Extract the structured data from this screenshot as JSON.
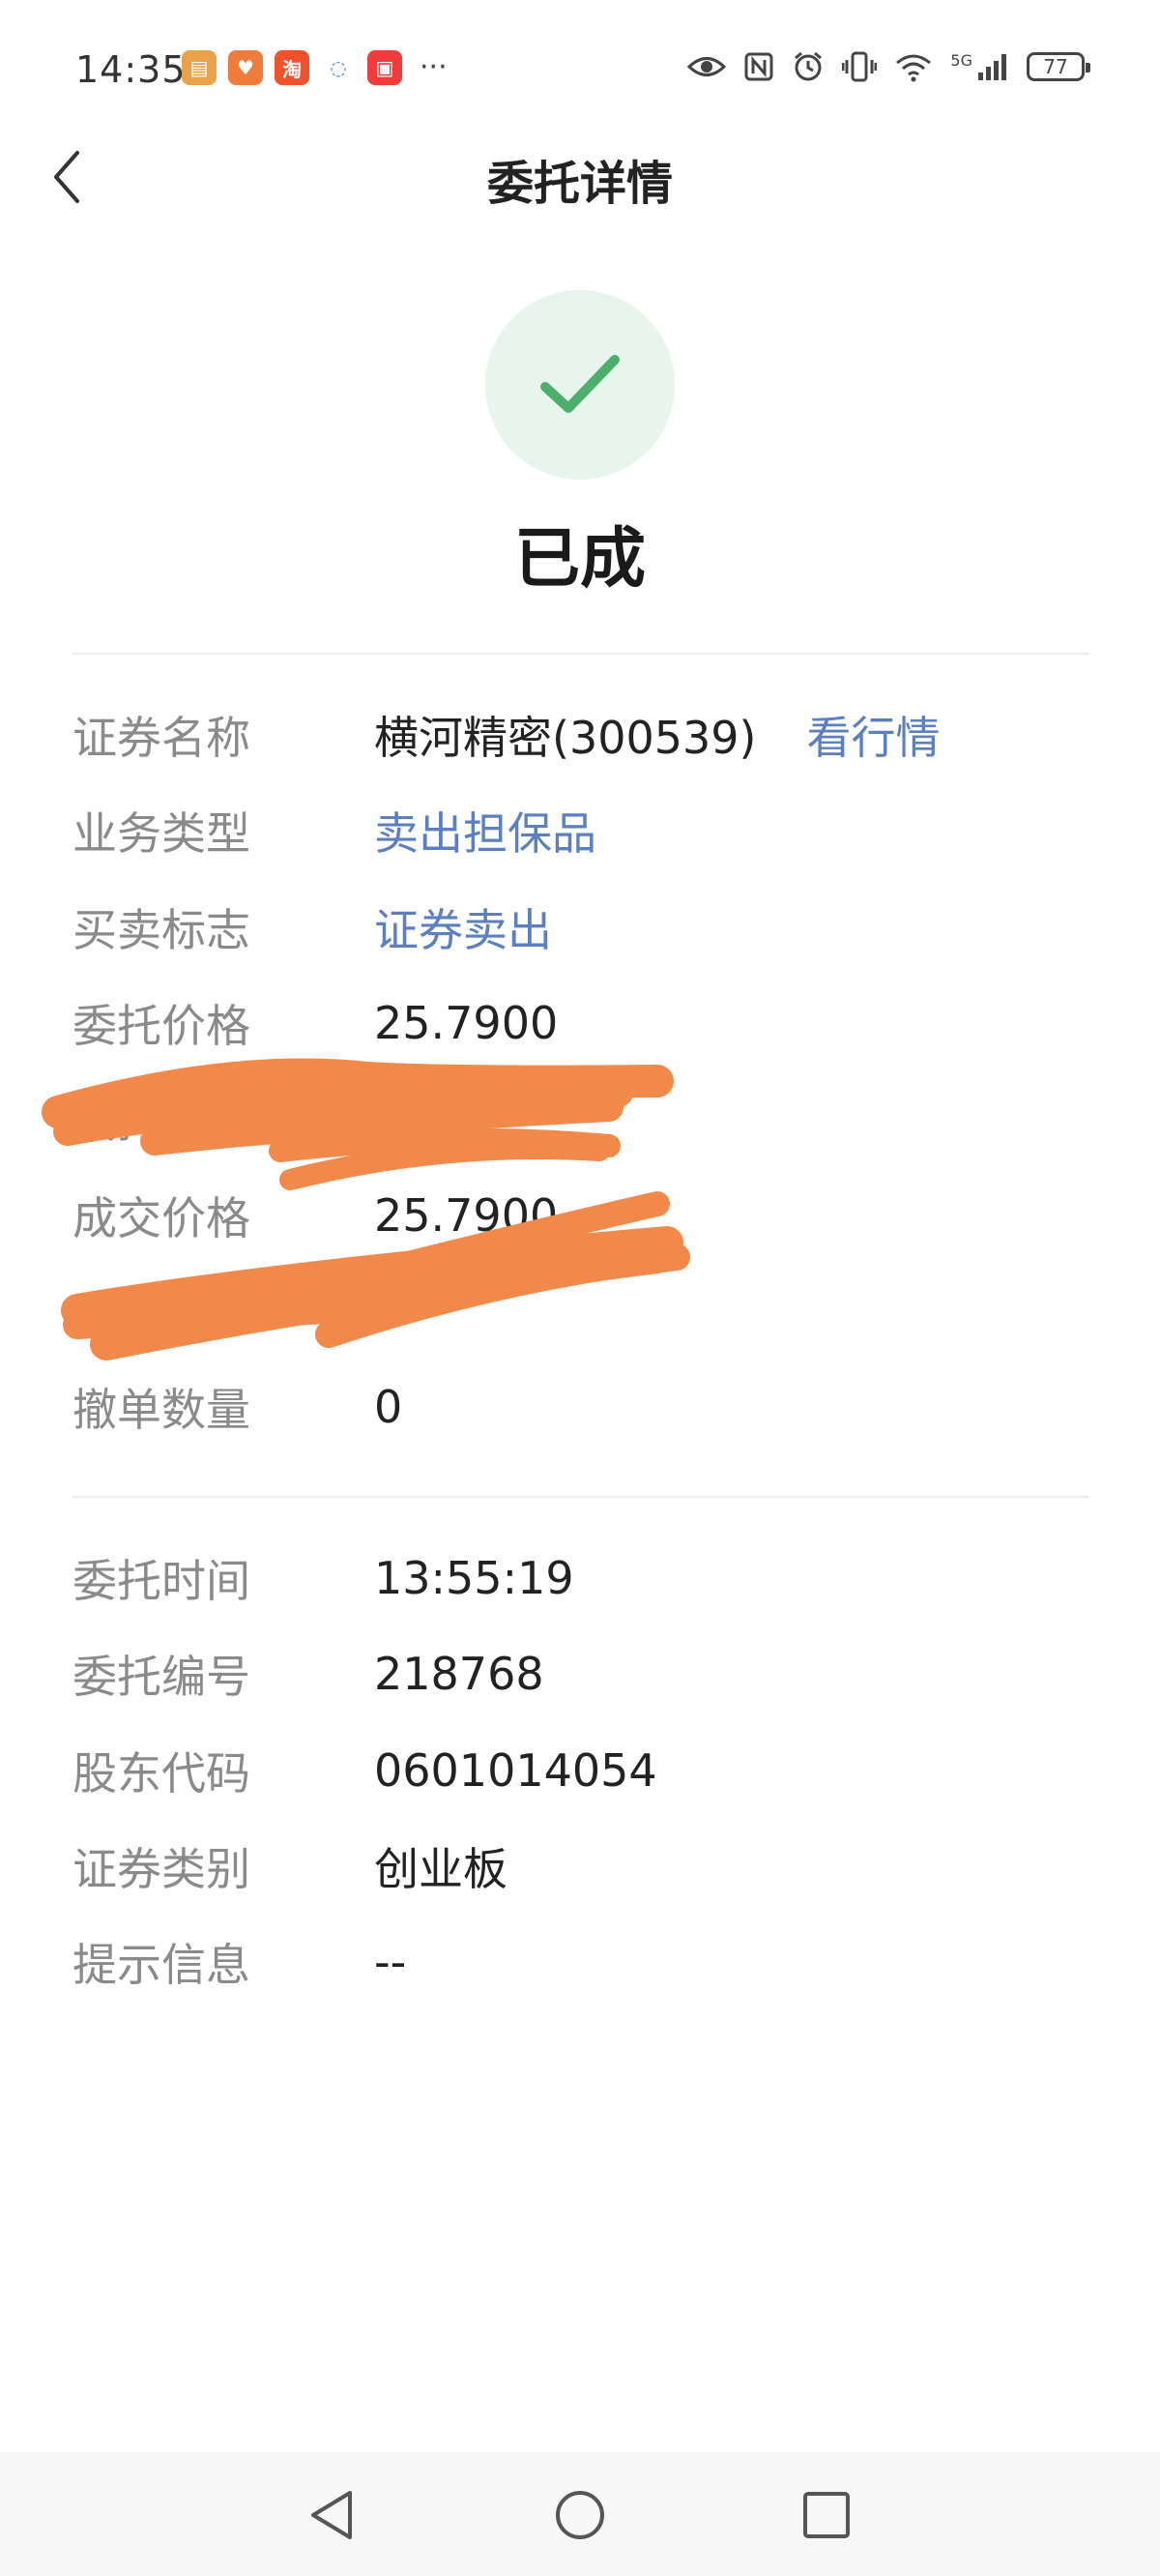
{
  "status_bar": {
    "time": "14:35",
    "more": "···",
    "signal_label": "5G",
    "battery": "77"
  },
  "header": {
    "title": "委托详情"
  },
  "status": {
    "text": "已成",
    "icon": "check-icon",
    "accent_color": "#4caf6e"
  },
  "section1": [
    {
      "label": "证券名称",
      "value": "横河精密(300539)",
      "link": "看行情"
    },
    {
      "label": "业务类型",
      "value": "卖出担保品",
      "is_link": true
    },
    {
      "label": "买卖标志",
      "value": "证券卖出",
      "is_link": true
    },
    {
      "label": "委托价格",
      "value": "25.7900"
    },
    {
      "label": "委托数量",
      "value": ""
    },
    {
      "label": "成交价格",
      "value": "25.7900"
    },
    {
      "label": "成交数量",
      "value": ""
    },
    {
      "label": "撤单数量",
      "value": "0"
    }
  ],
  "section2": [
    {
      "label": "委托时间",
      "value": "13:55:19"
    },
    {
      "label": "委托编号",
      "value": "218768"
    },
    {
      "label": "股东代码",
      "value": "0601014054"
    },
    {
      "label": "证券类别",
      "value": "创业板"
    },
    {
      "label": "提示信息",
      "value": "--"
    }
  ]
}
